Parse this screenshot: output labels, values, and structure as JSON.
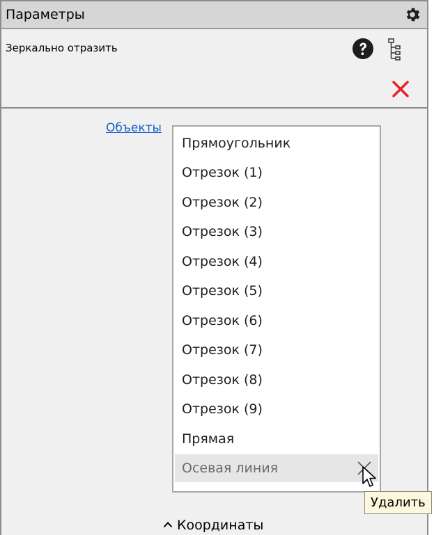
{
  "panel": {
    "title": "Параметры",
    "command_name": "Зеркально отразить",
    "objects_link": "Объекты",
    "objects": [
      "Прямоугольник",
      "Отрезок (1)",
      "Отрезок (2)",
      "Отрезок (3)",
      "Отрезок (4)",
      "Отрезок (5)",
      "Отрезок (6)",
      "Отрезок (7)",
      "Отрезок (8)",
      "Отрезок (9)",
      "Прямая",
      "Осевая линия"
    ],
    "hovered_index": 11,
    "tooltip": "Удалить",
    "coordinates_section": "Координаты"
  },
  "icons": {
    "settings": "gear-icon",
    "help": "help-icon",
    "tree": "tree-icon",
    "close": "close-icon",
    "delete": "delete-icon",
    "expand": "chevron-up-icon"
  },
  "colors": {
    "close_red": "#e8202a",
    "link_blue": "#1a64c8",
    "tooltip_bg": "#fdf8dc"
  }
}
